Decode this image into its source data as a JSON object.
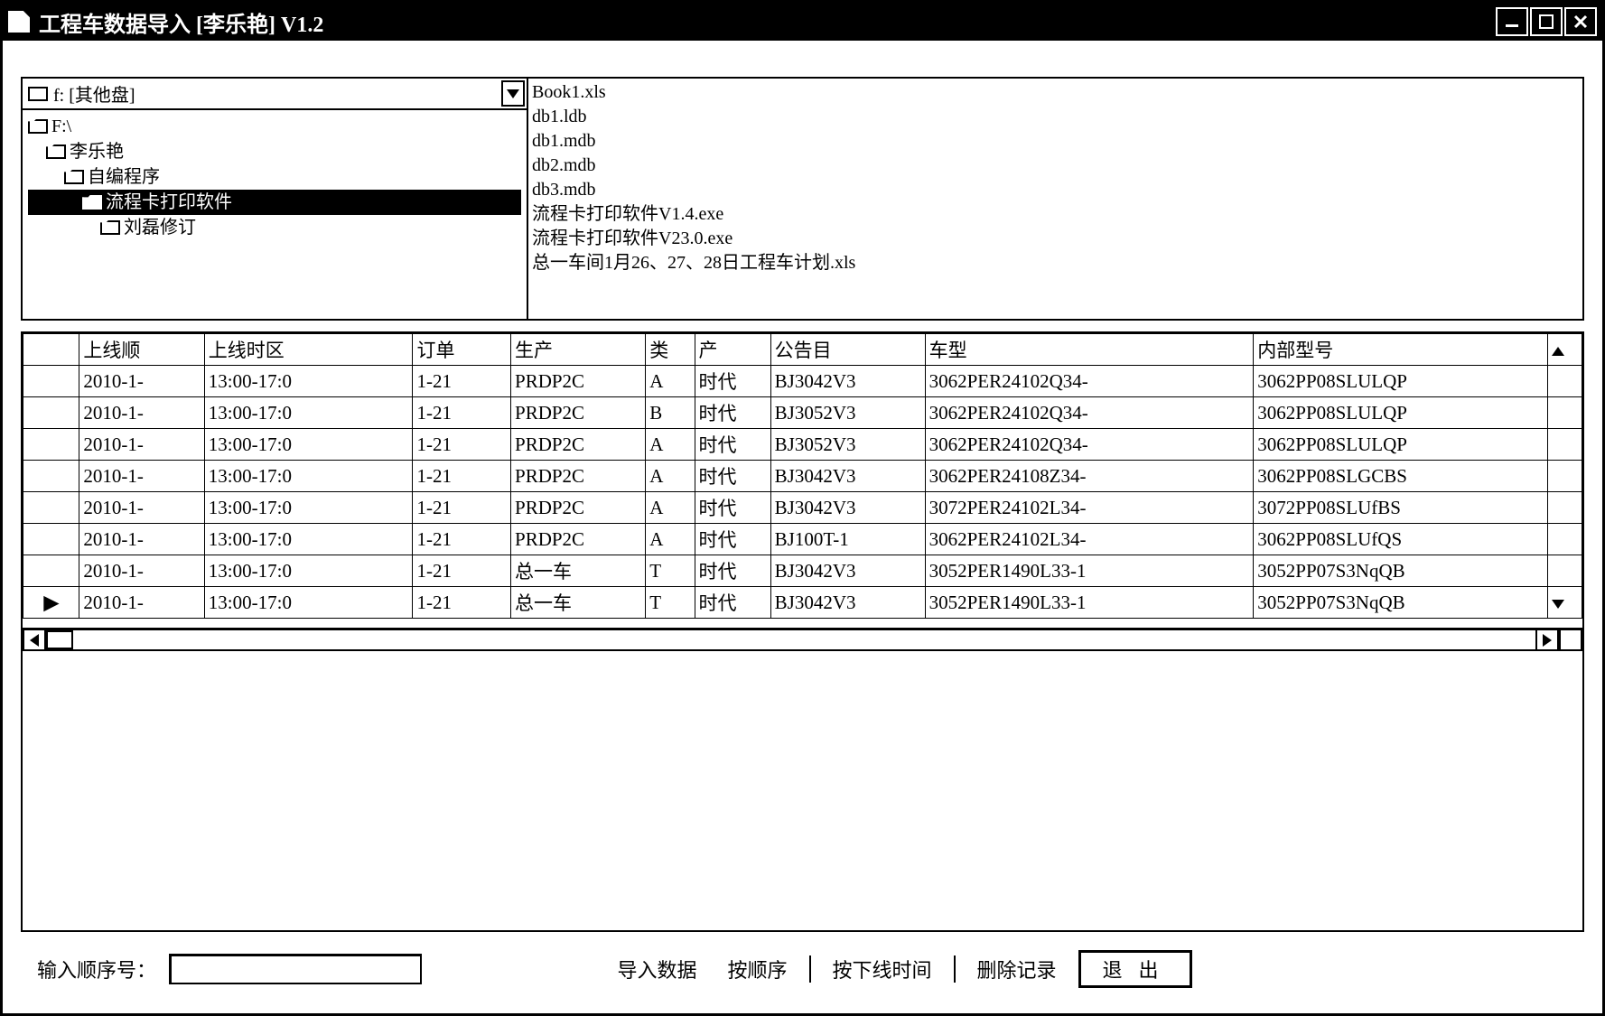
{
  "window": {
    "title": "工程车数据导入 [李乐艳] V1.2"
  },
  "drive": {
    "label": "f: [其他盘]"
  },
  "tree": {
    "root": "F:\\",
    "n1": "李乐艳",
    "n2": "自编程序",
    "n3": "流程卡打印软件",
    "n4": "刘磊修订"
  },
  "files": [
    "Book1.xls",
    "db1.ldb",
    "db1.mdb",
    "db2.mdb",
    "db3.mdb",
    "流程卡打印软件V1.4.exe",
    "流程卡打印软件V23.0.exe",
    "总一车间1月26、27、28日工程车计划.xls"
  ],
  "table": {
    "headers": [
      "上线顺",
      "上线时区",
      "订单",
      "生产",
      "类",
      "产",
      "公告目",
      "车型",
      "内部型号"
    ],
    "rows": [
      {
        "c0": "",
        "c1": "2010-1-",
        "c2": "13:00-17:0",
        "c3": "1-21",
        "c4": "PRDP2C",
        "c5": "A",
        "c6": "时代",
        "c7": "BJ3042V3",
        "c8": "3062PER24102Q34-",
        "c9": "3062PP08SLULQP"
      },
      {
        "c0": "",
        "c1": "2010-1-",
        "c2": "13:00-17:0",
        "c3": "1-21",
        "c4": "PRDP2C",
        "c5": "B",
        "c6": "时代",
        "c7": "BJ3052V3",
        "c8": "3062PER24102Q34-",
        "c9": "3062PP08SLULQP"
      },
      {
        "c0": "",
        "c1": "2010-1-",
        "c2": "13:00-17:0",
        "c3": "1-21",
        "c4": "PRDP2C",
        "c5": "A",
        "c6": "时代",
        "c7": "BJ3052V3",
        "c8": "3062PER24102Q34-",
        "c9": "3062PP08SLULQP"
      },
      {
        "c0": "",
        "c1": "2010-1-",
        "c2": "13:00-17:0",
        "c3": "1-21",
        "c4": "PRDP2C",
        "c5": "A",
        "c6": "时代",
        "c7": "BJ3042V3",
        "c8": "3062PER24108Z34-",
        "c9": "3062PP08SLGCBS"
      },
      {
        "c0": "",
        "c1": "2010-1-",
        "c2": "13:00-17:0",
        "c3": "1-21",
        "c4": "PRDP2C",
        "c5": "A",
        "c6": "时代",
        "c7": "BJ3042V3",
        "c8": "3072PER24102L34-",
        "c9": "3072PP08SLUfBS"
      },
      {
        "c0": "",
        "c1": "2010-1-",
        "c2": "13:00-17:0",
        "c3": "1-21",
        "c4": "PRDP2C",
        "c5": "A",
        "c6": "时代",
        "c7": "BJ100T-1",
        "c8": "3062PER24102L34-",
        "c9": "3062PP08SLUfQS"
      },
      {
        "c0": "",
        "c1": "2010-1-",
        "c2": "13:00-17:0",
        "c3": "1-21",
        "c4": "总一车",
        "c5": "T",
        "c6": "时代",
        "c7": "BJ3042V3",
        "c8": "3052PER1490L33-1",
        "c9": "3052PP07S3NqQB"
      },
      {
        "c0": "▶",
        "c1": "2010-1-",
        "c2": "13:00-17:0",
        "c3": "1-21",
        "c4": "总一车",
        "c5": "T",
        "c6": "时代",
        "c7": "BJ3042V3",
        "c8": "3052PER1490L33-1",
        "c9": "3052PP07S3NqQB"
      }
    ]
  },
  "bottom": {
    "seq_label": "输入顺序号：",
    "import": "导入数据",
    "by_seq": "按顺序",
    "by_time": "按下线时间",
    "delete": "删除记录",
    "exit": "退出"
  }
}
